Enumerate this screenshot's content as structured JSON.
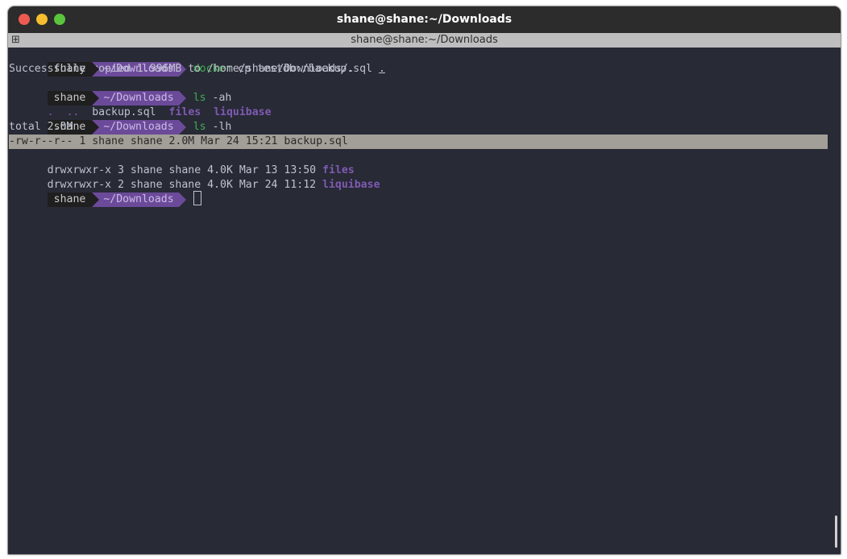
{
  "window": {
    "title": "shane@shane:~/Downloads",
    "tab_title": "shane@shane:~/Downloads",
    "tab_menu_icon": "⊞"
  },
  "prompt": {
    "user": "shane",
    "dir": "~/Downloads"
  },
  "lines": {
    "cmd1_name": "docker",
    "cmd1_args": " cp testdb:/backup.sql ",
    "cmd1_dot": ".",
    "out1": "Successfully copied 1.996MB to /home/shane/Downloads/.",
    "cmd2_name": "ls",
    "cmd2_args": " -ah",
    "out2_dots": ".  ..  ",
    "out2_file": "backup.sql  ",
    "out2_dir1": "files",
    "out2_sep": "  ",
    "out2_dir2": "liquibase",
    "cmd3_name": "ls",
    "cmd3_args": " -lh",
    "out3_total": "total 2.0M",
    "row1": "-rw-r--r-- 1 shane shane 2.0M Mar 24 15:21 backup.sql",
    "row2_meta": "drwxrwxr-x 3 shane shane 4.0K Mar 13 13:50 ",
    "row2_name": "files",
    "row3_meta": "drwxrwxr-x 2 shane shane 4.0K Mar 24 11:12 ",
    "row3_name": "liquibase"
  },
  "colors": {
    "background": "#282a36",
    "command": "#3eb04f",
    "directory": "#7f5ab2",
    "prompt_dir_bg": "#6c4a9a",
    "prompt_user_bg": "#1f1f1f",
    "selection": "#a19f97"
  }
}
